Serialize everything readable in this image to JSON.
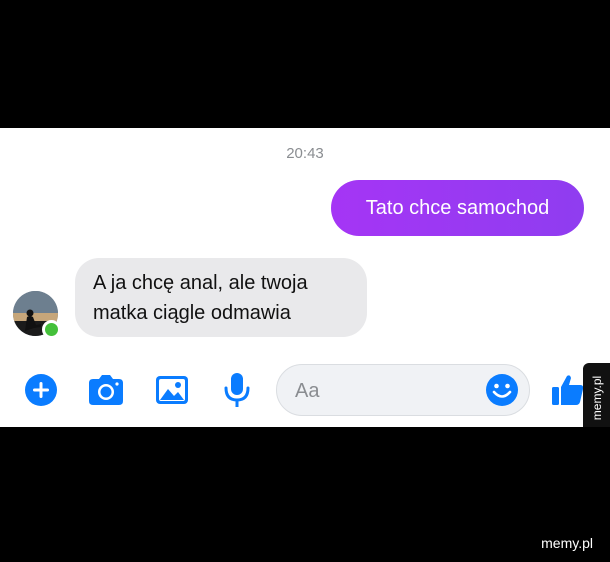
{
  "conversation": {
    "timestamp": "20:43",
    "messages": [
      {
        "direction": "outgoing",
        "text": "Tato chce samochod"
      },
      {
        "direction": "incoming",
        "text": "A ja chcę anal, ale twoja matka ciągle odmawia"
      }
    ],
    "contact": {
      "online": true
    }
  },
  "composer": {
    "placeholder": "Aa",
    "icons": [
      "plus-circle-icon",
      "camera-icon",
      "image-icon",
      "microphone-icon",
      "emoji-icon",
      "thumbs-up-icon"
    ]
  },
  "branding": {
    "side_tab": "memy.pl",
    "watermark": "memy.pl"
  },
  "colors": {
    "accent_blue": "#0a7cff",
    "outgoing_bubble": "#9b39f3",
    "incoming_bubble": "#e9e9eb",
    "online": "#44c03a"
  }
}
